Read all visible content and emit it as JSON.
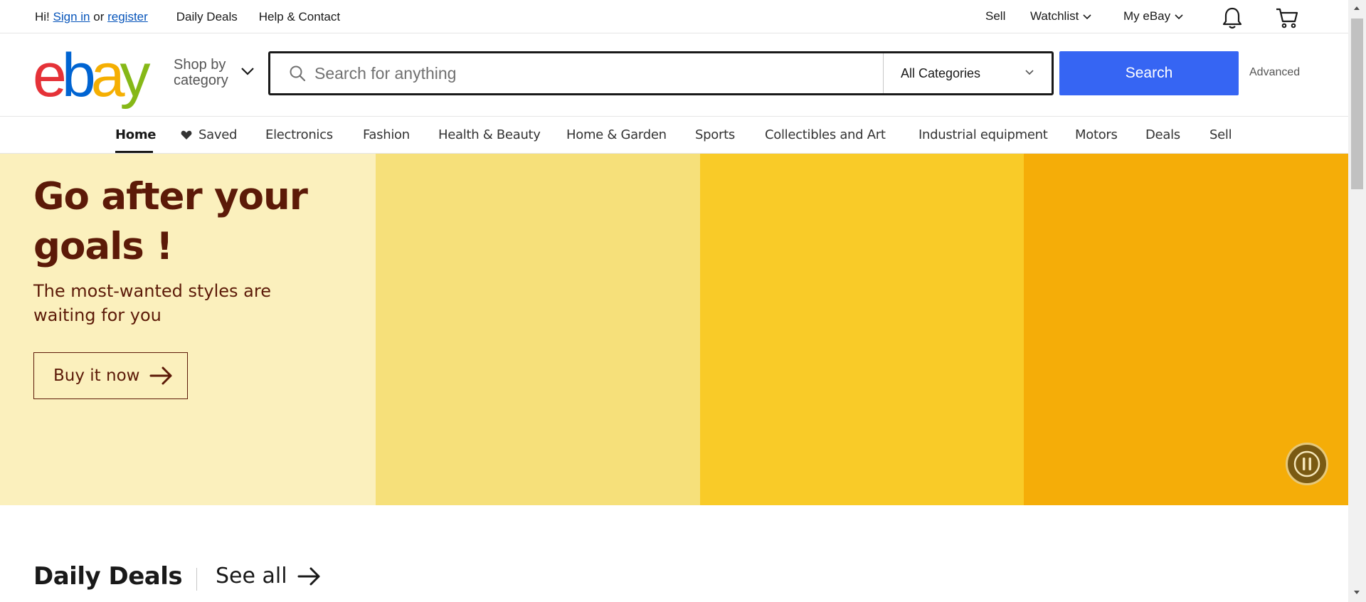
{
  "topbar": {
    "greeting": "Hi!",
    "sign_in": "Sign in",
    "or": "or",
    "register": "register",
    "daily_deals": "Daily Deals",
    "help_contact": "Help & Contact",
    "sell": "Sell",
    "watchlist": "Watchlist",
    "my_ebay": "My eBay"
  },
  "header": {
    "logo_letters": [
      "e",
      "b",
      "a",
      "y"
    ],
    "logo_colors": [
      "#e53238",
      "#0064d2",
      "#f5af02",
      "#86b817"
    ],
    "shop_by_line1": "Shop by",
    "shop_by_line2": "category",
    "search_placeholder": "Search for anything",
    "category_selected": "All Categories",
    "search_button": "Search",
    "advanced": "Advanced"
  },
  "nav": {
    "items": [
      {
        "label": "Home",
        "active": true
      },
      {
        "label": "Saved"
      },
      {
        "label": "Electronics"
      },
      {
        "label": "Fashion"
      },
      {
        "label": "Health & Beauty"
      },
      {
        "label": "Home & Garden"
      },
      {
        "label": "Sports"
      },
      {
        "label": "Collectibles and Art"
      },
      {
        "label": "Industrial equipment"
      },
      {
        "label": "Motors"
      },
      {
        "label": "Deals"
      },
      {
        "label": "Sell"
      }
    ]
  },
  "hero": {
    "title": "Go after your goals !",
    "subtitle": "The most-wanted styles are waiting for you",
    "cta": "Buy it now",
    "band_colors": [
      "#fbf0bd",
      "#f6e07a",
      "#f9cb28",
      "#f5ad08"
    ],
    "text_color": "#5c1a08"
  },
  "deals": {
    "title": "Daily Deals",
    "see_all": "See all"
  },
  "colors": {
    "search_blue": "#3665f3",
    "link_blue": "#0654ba"
  }
}
